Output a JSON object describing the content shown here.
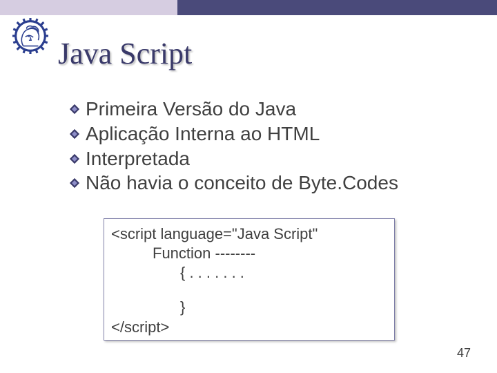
{
  "title": "Java Script",
  "bullets": [
    "Primeira Versão do Java",
    "Aplicação Interna ao HTML",
    "Interpretada",
    "Não havia o conceito de Byte.Codes"
  ],
  "code": {
    "line1": "<script language=\"Java Script\"",
    "line2": "Function --------",
    "line3": "{ . . . . . . .",
    "line4": "}",
    "line5": "</script>"
  },
  "page_number": "47"
}
